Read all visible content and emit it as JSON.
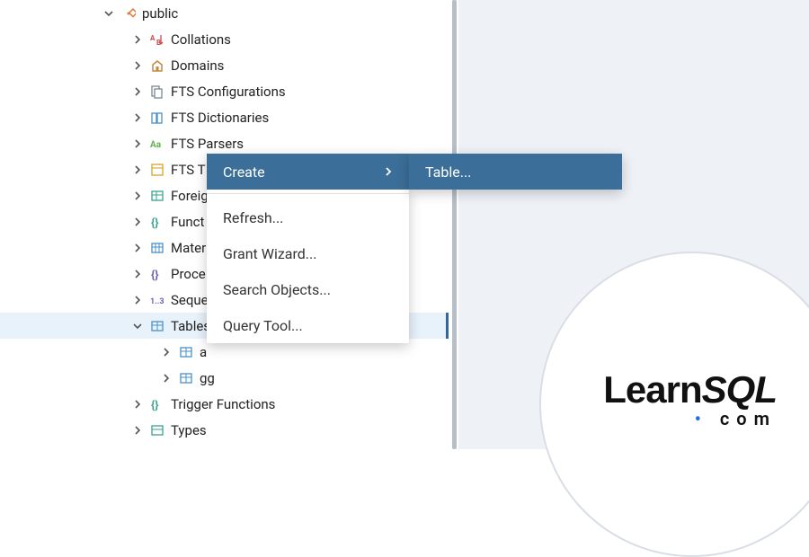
{
  "tree": {
    "root": {
      "label": "public",
      "expanded": true,
      "children": [
        {
          "label": "Collations",
          "icon": "collations",
          "expanded": false
        },
        {
          "label": "Domains",
          "icon": "domains",
          "expanded": false
        },
        {
          "label": "FTS Configurations",
          "icon": "fts-config",
          "expanded": false
        },
        {
          "label": "FTS Dictionaries",
          "icon": "fts-dict",
          "expanded": false
        },
        {
          "label": "FTS Parsers",
          "icon": "fts-parsers",
          "expanded": false
        },
        {
          "label": "FTS Templates",
          "icon": "fts-templates",
          "expanded": false,
          "truncate": "FTS T"
        },
        {
          "label": "Foreign Tables",
          "icon": "foreign",
          "expanded": false,
          "truncate": "Foreig"
        },
        {
          "label": "Functions",
          "icon": "functions",
          "expanded": false,
          "truncate": "Funct"
        },
        {
          "label": "Materialized Views",
          "icon": "matviews",
          "expanded": false,
          "truncate": "Mater"
        },
        {
          "label": "Procedures",
          "icon": "procedures",
          "expanded": false,
          "truncate": "Proce"
        },
        {
          "label": "Sequences",
          "icon": "sequences",
          "expanded": false,
          "truncate": "Seque"
        },
        {
          "label": "Tables",
          "icon": "tables",
          "expanded": true,
          "selected": true,
          "truncate": "Tables",
          "children": [
            {
              "label": "a",
              "icon": "table",
              "expanded": false
            },
            {
              "label": "gg",
              "icon": "table",
              "expanded": false
            }
          ]
        },
        {
          "label": "Trigger Functions",
          "icon": "trigger",
          "expanded": false
        },
        {
          "label": "Types",
          "icon": "types",
          "expanded": false
        }
      ]
    }
  },
  "context_menu": {
    "items": [
      {
        "label": "Create",
        "submenu": true,
        "highlight": true
      },
      {
        "separator": true
      },
      {
        "label": "Refresh..."
      },
      {
        "label": "Grant Wizard..."
      },
      {
        "label": "Search Objects..."
      },
      {
        "label": "Query Tool..."
      }
    ],
    "submenu_items": [
      {
        "label": "Table...",
        "highlight": true
      }
    ]
  },
  "logo": {
    "name": "LearnSQL",
    "learn": "Learn",
    "sql": "SQL",
    "dot": "•",
    "com": "com"
  },
  "colors": {
    "accent": "#3b6e98",
    "selection": "#e8f2fb"
  }
}
